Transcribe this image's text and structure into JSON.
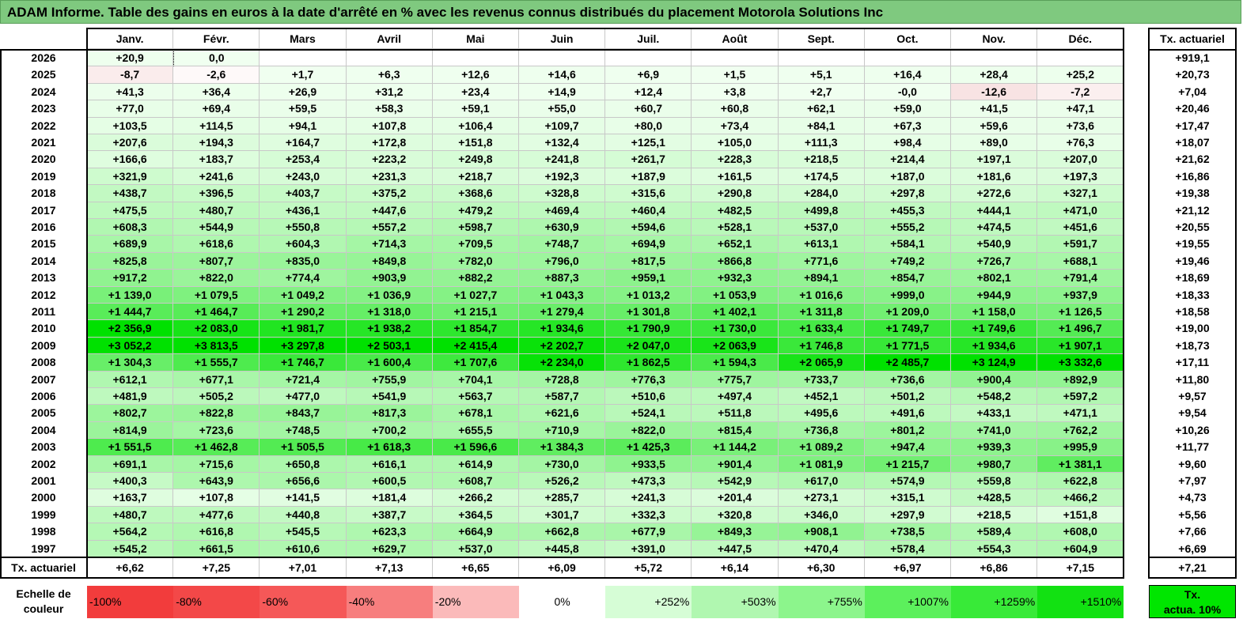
{
  "title": "ADAM Informe. Table des gains en euros à la date d'arrêté en % avec les revenus connus distribués du placement Motorola Solutions Inc",
  "months": [
    "Janv.",
    "Févr.",
    "Mars",
    "Avril",
    "Mai",
    "Juin",
    "Juil.",
    "Août",
    "Sept.",
    "Oct.",
    "Nov.",
    "Déc."
  ],
  "actuarial_header": "Tx. actuariel",
  "rows": [
    {
      "year": "2026",
      "values": [
        "+20,9",
        "0,0",
        "",
        "",
        "",
        "",
        "",
        "",
        "",
        "",
        "",
        ""
      ],
      "rate": "+919,1"
    },
    {
      "year": "2025",
      "values": [
        "-8,7",
        "-2,6",
        "+1,7",
        "+6,3",
        "+12,6",
        "+14,6",
        "+6,9",
        "+1,5",
        "+5,1",
        "+16,4",
        "+28,4",
        "+25,2"
      ],
      "rate": "+20,73"
    },
    {
      "year": "2024",
      "values": [
        "+41,3",
        "+36,4",
        "+26,9",
        "+31,2",
        "+23,4",
        "+14,9",
        "+12,4",
        "+3,8",
        "+2,7",
        "-0,0",
        "-12,6",
        "-7,2"
      ],
      "rate": "+7,04"
    },
    {
      "year": "2023",
      "values": [
        "+77,0",
        "+69,4",
        "+59,5",
        "+58,3",
        "+59,1",
        "+55,0",
        "+60,7",
        "+60,8",
        "+62,1",
        "+59,0",
        "+41,5",
        "+47,1"
      ],
      "rate": "+20,46"
    },
    {
      "year": "2022",
      "values": [
        "+103,5",
        "+114,5",
        "+94,1",
        "+107,8",
        "+106,4",
        "+109,7",
        "+80,0",
        "+73,4",
        "+84,1",
        "+67,3",
        "+59,6",
        "+73,6"
      ],
      "rate": "+17,47"
    },
    {
      "year": "2021",
      "values": [
        "+207,6",
        "+194,3",
        "+164,7",
        "+172,8",
        "+151,8",
        "+132,4",
        "+125,1",
        "+105,0",
        "+111,3",
        "+98,4",
        "+89,0",
        "+76,3"
      ],
      "rate": "+18,07"
    },
    {
      "year": "2020",
      "values": [
        "+166,6",
        "+183,7",
        "+253,4",
        "+223,2",
        "+249,8",
        "+241,8",
        "+261,7",
        "+228,3",
        "+218,5",
        "+214,4",
        "+197,1",
        "+207,0"
      ],
      "rate": "+21,62"
    },
    {
      "year": "2019",
      "values": [
        "+321,9",
        "+241,6",
        "+243,0",
        "+231,3",
        "+218,7",
        "+192,3",
        "+187,9",
        "+161,5",
        "+174,5",
        "+187,0",
        "+181,6",
        "+197,3"
      ],
      "rate": "+16,86"
    },
    {
      "year": "2018",
      "values": [
        "+438,7",
        "+396,5",
        "+403,7",
        "+375,2",
        "+368,6",
        "+328,8",
        "+315,6",
        "+290,8",
        "+284,0",
        "+297,8",
        "+272,6",
        "+327,1"
      ],
      "rate": "+19,38"
    },
    {
      "year": "2017",
      "values": [
        "+475,5",
        "+480,7",
        "+436,1",
        "+447,6",
        "+479,2",
        "+469,4",
        "+460,4",
        "+482,5",
        "+499,8",
        "+455,3",
        "+444,1",
        "+471,0"
      ],
      "rate": "+21,12"
    },
    {
      "year": "2016",
      "values": [
        "+608,3",
        "+544,9",
        "+550,8",
        "+557,2",
        "+598,7",
        "+630,9",
        "+594,6",
        "+528,1",
        "+537,0",
        "+555,2",
        "+474,5",
        "+451,6"
      ],
      "rate": "+20,55"
    },
    {
      "year": "2015",
      "values": [
        "+689,9",
        "+618,6",
        "+604,3",
        "+714,3",
        "+709,5",
        "+748,7",
        "+694,9",
        "+652,1",
        "+613,1",
        "+584,1",
        "+540,9",
        "+591,7"
      ],
      "rate": "+19,55"
    },
    {
      "year": "2014",
      "values": [
        "+825,8",
        "+807,7",
        "+835,0",
        "+849,8",
        "+782,0",
        "+796,0",
        "+817,5",
        "+866,8",
        "+771,6",
        "+749,2",
        "+726,7",
        "+688,1"
      ],
      "rate": "+19,46"
    },
    {
      "year": "2013",
      "values": [
        "+917,2",
        "+822,0",
        "+774,4",
        "+903,9",
        "+882,2",
        "+887,3",
        "+959,1",
        "+932,3",
        "+894,1",
        "+854,7",
        "+802,1",
        "+791,4"
      ],
      "rate": "+18,69"
    },
    {
      "year": "2012",
      "values": [
        "+1 139,0",
        "+1 079,5",
        "+1 049,2",
        "+1 036,9",
        "+1 027,7",
        "+1 043,3",
        "+1 013,2",
        "+1 053,9",
        "+1 016,6",
        "+999,0",
        "+944,9",
        "+937,9"
      ],
      "rate": "+18,33"
    },
    {
      "year": "2011",
      "values": [
        "+1 444,7",
        "+1 464,7",
        "+1 290,2",
        "+1 318,0",
        "+1 215,1",
        "+1 279,4",
        "+1 301,8",
        "+1 402,1",
        "+1 311,8",
        "+1 209,0",
        "+1 158,0",
        "+1 126,5"
      ],
      "rate": "+18,58"
    },
    {
      "year": "2010",
      "values": [
        "+2 356,9",
        "+2 083,0",
        "+1 981,7",
        "+1 938,2",
        "+1 854,7",
        "+1 934,6",
        "+1 790,9",
        "+1 730,0",
        "+1 633,4",
        "+1 749,7",
        "+1 749,6",
        "+1 496,7"
      ],
      "rate": "+19,00"
    },
    {
      "year": "2009",
      "values": [
        "+3 052,2",
        "+3 813,5",
        "+3 297,8",
        "+2 503,1",
        "+2 415,4",
        "+2 202,7",
        "+2 047,0",
        "+2 063,9",
        "+1 746,8",
        "+1 771,5",
        "+1 934,6",
        "+1 907,1"
      ],
      "rate": "+18,73"
    },
    {
      "year": "2008",
      "values": [
        "+1 304,3",
        "+1 555,7",
        "+1 746,7",
        "+1 600,4",
        "+1 707,6",
        "+2 234,0",
        "+1 862,5",
        "+1 594,3",
        "+2 065,9",
        "+2 485,7",
        "+3 124,9",
        "+3 332,6"
      ],
      "rate": "+17,11"
    },
    {
      "year": "2007",
      "values": [
        "+612,1",
        "+677,1",
        "+721,4",
        "+755,9",
        "+704,1",
        "+728,8",
        "+776,3",
        "+775,7",
        "+733,7",
        "+736,6",
        "+900,4",
        "+892,9"
      ],
      "rate": "+11,80"
    },
    {
      "year": "2006",
      "values": [
        "+481,9",
        "+505,2",
        "+477,0",
        "+541,9",
        "+563,7",
        "+587,7",
        "+510,6",
        "+497,4",
        "+452,1",
        "+501,2",
        "+548,2",
        "+597,2"
      ],
      "rate": "+9,57"
    },
    {
      "year": "2005",
      "values": [
        "+802,7",
        "+822,8",
        "+843,7",
        "+817,3",
        "+678,1",
        "+621,6",
        "+524,1",
        "+511,8",
        "+495,6",
        "+491,6",
        "+433,1",
        "+471,1"
      ],
      "rate": "+9,54"
    },
    {
      "year": "2004",
      "values": [
        "+814,9",
        "+723,6",
        "+748,5",
        "+700,2",
        "+655,5",
        "+710,9",
        "+822,0",
        "+815,4",
        "+736,8",
        "+801,2",
        "+741,0",
        "+762,2"
      ],
      "rate": "+10,26"
    },
    {
      "year": "2003",
      "values": [
        "+1 551,5",
        "+1 462,8",
        "+1 505,5",
        "+1 618,3",
        "+1 596,6",
        "+1 384,3",
        "+1 425,3",
        "+1 144,2",
        "+1 089,2",
        "+947,4",
        "+939,3",
        "+995,9"
      ],
      "rate": "+11,77"
    },
    {
      "year": "2002",
      "values": [
        "+691,1",
        "+715,6",
        "+650,8",
        "+616,1",
        "+614,9",
        "+730,0",
        "+933,5",
        "+901,4",
        "+1 081,9",
        "+1 215,7",
        "+980,7",
        "+1 381,1"
      ],
      "rate": "+9,60"
    },
    {
      "year": "2001",
      "values": [
        "+400,3",
        "+643,9",
        "+656,6",
        "+600,5",
        "+608,7",
        "+526,2",
        "+473,3",
        "+542,9",
        "+617,0",
        "+574,9",
        "+559,8",
        "+622,8"
      ],
      "rate": "+7,97"
    },
    {
      "year": "2000",
      "values": [
        "+163,7",
        "+107,8",
        "+141,5",
        "+181,4",
        "+266,2",
        "+285,7",
        "+241,3",
        "+201,4",
        "+273,1",
        "+315,1",
        "+428,5",
        "+466,2"
      ],
      "rate": "+4,73"
    },
    {
      "year": "1999",
      "values": [
        "+480,7",
        "+477,6",
        "+440,8",
        "+387,7",
        "+364,5",
        "+301,7",
        "+332,3",
        "+320,8",
        "+346,0",
        "+297,9",
        "+218,5",
        "+151,8"
      ],
      "rate": "+5,56"
    },
    {
      "year": "1998",
      "values": [
        "+564,2",
        "+616,8",
        "+545,5",
        "+623,3",
        "+664,9",
        "+662,8",
        "+677,9",
        "+849,3",
        "+908,1",
        "+738,5",
        "+589,4",
        "+608,0"
      ],
      "rate": "+7,66"
    },
    {
      "year": "1997",
      "values": [
        "+545,2",
        "+661,5",
        "+610,6",
        "+629,7",
        "+537,0",
        "+445,8",
        "+391,0",
        "+447,5",
        "+470,4",
        "+578,4",
        "+554,3",
        "+604,9"
      ],
      "rate": "+6,69"
    }
  ],
  "footer": {
    "label": "Tx. actuariel",
    "values": [
      "+6,62",
      "+7,25",
      "+7,01",
      "+7,13",
      "+6,65",
      "+6,09",
      "+5,72",
      "+6,14",
      "+6,30",
      "+6,97",
      "+6,86",
      "+7,15"
    ],
    "rate": "+7,21"
  },
  "scale": {
    "label_line1": "Echelle de",
    "label_line2": "couleur",
    "items": [
      {
        "label": "-100%",
        "color": "#f23c3c"
      },
      {
        "label": "-80%",
        "color": "#f34848"
      },
      {
        "label": "-60%",
        "color": "#f55858"
      },
      {
        "label": "-40%",
        "color": "#f77e7e"
      },
      {
        "label": "-20%",
        "color": "#fbbaba"
      },
      {
        "label": "0%",
        "color": "#ffffff"
      },
      {
        "label": "+252%",
        "color": "#d6fdd6"
      },
      {
        "label": "+503%",
        "color": "#b0f7b0"
      },
      {
        "label": "+755%",
        "color": "#8cf58c"
      },
      {
        "label": "+1007%",
        "color": "#5cf05c"
      },
      {
        "label": "+1259%",
        "color": "#38ea38"
      },
      {
        "label": "+1510%",
        "color": "#12e112"
      }
    ],
    "act_line1": "Tx.",
    "act_line2": "actua. 10%"
  }
}
